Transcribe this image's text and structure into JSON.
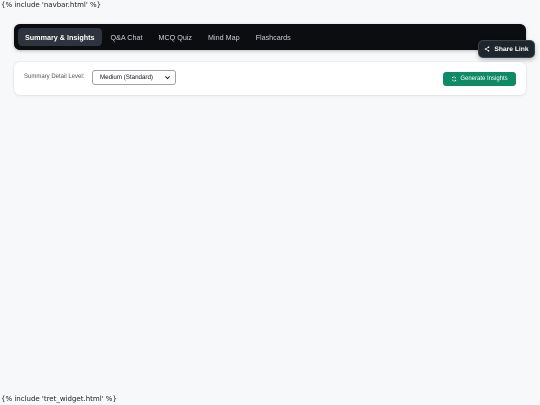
{
  "template": {
    "navbar_include": "{% include 'navbar.html' %}",
    "widget_include": "{% include 'tret_widget.html' %}"
  },
  "tabs": [
    {
      "label": "Summary & Insights",
      "active": true
    },
    {
      "label": "Q&A Chat",
      "active": false
    },
    {
      "label": "MCQ Quiz",
      "active": false
    },
    {
      "label": "Mind Map",
      "active": false
    },
    {
      "label": "Flashcards",
      "active": false
    }
  ],
  "share": {
    "label": "Share Link",
    "icon": "share-icon"
  },
  "controls": {
    "detail_label": "Summary Detail Level:",
    "detail_value": "Medium (Standard)",
    "generate_label": "Generate Insights",
    "generate_icon": "refresh-icon",
    "generate_color": "#0f8a67"
  }
}
